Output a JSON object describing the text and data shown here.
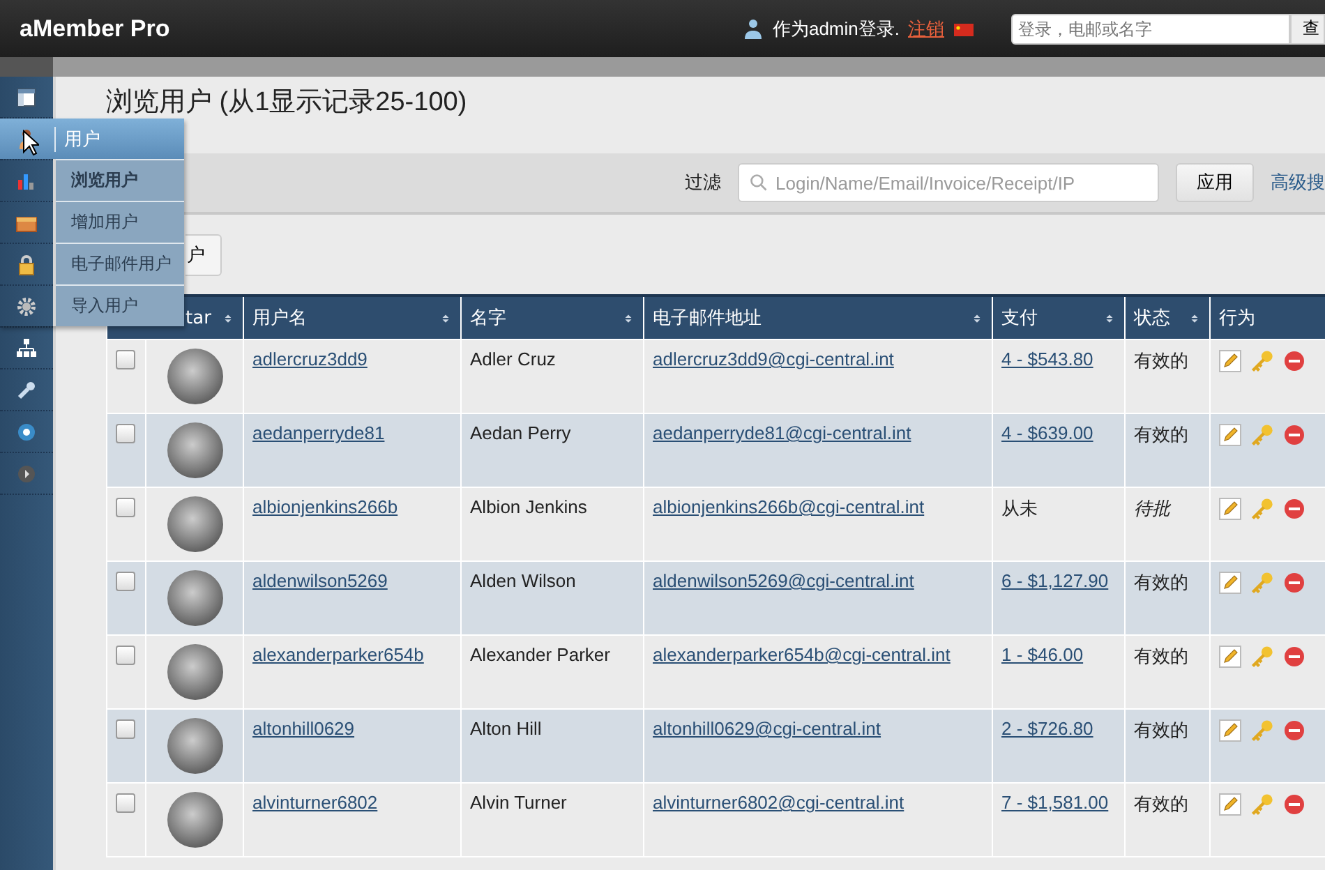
{
  "header": {
    "logo": "aMember Pro",
    "login_text": "作为admin登录.",
    "logout_link": "注销",
    "search": {
      "placeholder": "登录，电邮或名字"
    },
    "search_button": "查"
  },
  "flyout_menu": {
    "title": "用户",
    "items": [
      {
        "label": "浏览用户",
        "selected": true
      },
      {
        "label": "增加用户",
        "selected": false
      },
      {
        "label": "电子邮件用户",
        "selected": false
      },
      {
        "label": "导入用户",
        "selected": false
      }
    ]
  },
  "page_title": "浏览用户 (从1显示记录25-100)",
  "filter": {
    "label": "过滤",
    "placeholder": "Login/Name/Email/Invoice/Receipt/IP",
    "apply_button": "应用",
    "advanced_link": "高级搜"
  },
  "toolbar_button": "户",
  "table": {
    "columns": [
      {
        "label": "tar",
        "sortable": true
      },
      {
        "label": "用户名",
        "sortable": true
      },
      {
        "label": "名字",
        "sortable": true
      },
      {
        "label": "电子邮件地址",
        "sortable": true
      },
      {
        "label": "支付",
        "sortable": true
      },
      {
        "label": "状态",
        "sortable": true
      },
      {
        "label": "行为",
        "sortable": false
      }
    ],
    "rows": [
      {
        "checked": false,
        "login": "adlercruz3dd9",
        "name": "Adler Cruz",
        "email": "adlercruz3dd9@cgi-central.int",
        "payments": "4 - $543.80",
        "paid": true,
        "status": "有效的",
        "pending": false
      },
      {
        "checked": false,
        "login": "aedanperryde81",
        "name": "Aedan Perry",
        "email": "aedanperryde81@cgi-central.int",
        "payments": "4 - $639.00",
        "paid": true,
        "status": "有效的",
        "pending": false
      },
      {
        "checked": false,
        "login": "albionjenkins266b",
        "name": "Albion Jenkins",
        "email": "albionjenkins266b@cgi-central.int",
        "payments": "从未",
        "paid": false,
        "status": "待批",
        "pending": true
      },
      {
        "checked": false,
        "login": "aldenwilson5269",
        "name": "Alden Wilson",
        "email": "aldenwilson5269@cgi-central.int",
        "payments": "6 - $1,127.90",
        "paid": true,
        "status": "有效的",
        "pending": false
      },
      {
        "checked": false,
        "login": "alexanderparker654b",
        "name": "Alexander Parker",
        "email": "alexanderparker654b@cgi-central.int",
        "payments": "1 - $46.00",
        "paid": true,
        "status": "有效的",
        "pending": false
      },
      {
        "checked": false,
        "login": "altonhill0629",
        "name": "Alton Hill",
        "email": "altonhill0629@cgi-central.int",
        "payments": "2 - $726.80",
        "paid": true,
        "status": "有效的",
        "pending": false
      },
      {
        "checked": false,
        "login": "alvinturner6802",
        "name": "Alvin Turner",
        "email": "alvinturner6802@cgi-central.int",
        "payments": "7 - $1,581.00",
        "paid": true,
        "status": "有效的",
        "pending": false
      }
    ]
  }
}
